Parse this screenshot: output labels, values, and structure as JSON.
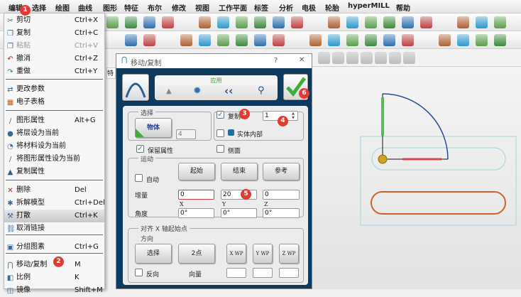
{
  "menubar": [
    "编辑",
    "选择",
    "绘图",
    "曲线",
    "图形",
    "特征",
    "布尔",
    "修改",
    "视图",
    "工作平面",
    "标签",
    "分析",
    "电极",
    "轮胎",
    "hyperMILL",
    "帮助"
  ],
  "edit_menu": [
    {
      "icon": "scissors-icon",
      "label": "剪切",
      "shortcut": "Ctrl+X"
    },
    {
      "icon": "copy-icon",
      "label": "复制",
      "shortcut": "Ctrl+C"
    },
    {
      "icon": "paste-icon",
      "label": "粘贴",
      "shortcut": "Ctrl+V",
      "disabled": true
    },
    {
      "icon": "undo-icon",
      "label": "撤消",
      "shortcut": "Ctrl+Z"
    },
    {
      "icon": "redo-icon",
      "label": "重做",
      "shortcut": "Ctrl+Y"
    },
    {
      "icon": "change-params-icon",
      "label": "更改参数",
      "shortcut": ""
    },
    {
      "icon": "spreadsheet-icon",
      "label": "电子表格",
      "shortcut": ""
    },
    {
      "icon": "pencil-icon",
      "label": "图形属性",
      "shortcut": "Alt+G"
    },
    {
      "icon": "layer-icon",
      "label": "将层设为当前",
      "shortcut": ""
    },
    {
      "icon": "material-icon",
      "label": "将材料设为当前",
      "shortcut": ""
    },
    {
      "icon": "attribute-icon",
      "label": "将图形属性设为当前",
      "shortcut": ""
    },
    {
      "icon": "brush-icon",
      "label": "复制属性",
      "shortcut": ""
    },
    {
      "icon": "delete-icon",
      "label": "删除",
      "shortcut": "Del"
    },
    {
      "icon": "explode-icon",
      "label": "拆解模型",
      "shortcut": "Ctrl+Del"
    },
    {
      "icon": "hammer-icon",
      "label": "打散",
      "shortcut": "Ctrl+K",
      "highlighted": true
    },
    {
      "icon": "unlink-icon",
      "label": "取消链接",
      "shortcut": ""
    },
    {
      "icon": "group-icon",
      "label": "分组图素",
      "shortcut": "Ctrl+G"
    },
    {
      "icon": "move-copy-icon",
      "label": "移动/复制",
      "shortcut": "M"
    },
    {
      "icon": "scale-icon",
      "label": "比例",
      "shortcut": "K"
    },
    {
      "icon": "mirror-icon",
      "label": "镜像",
      "shortcut": "Shift+M"
    }
  ],
  "badges": [
    "1",
    "2",
    "3",
    "4",
    "5",
    "6"
  ],
  "side_tab": "特",
  "dialog": {
    "title": "移动/复制",
    "help": "?",
    "close": "✕",
    "apply": "应用",
    "select_group": "选择",
    "object_btn": "物体",
    "object_count": "4",
    "copy_label": "复制",
    "copy_checked": true,
    "copy_count": "1",
    "solid_inside": "实体内部",
    "keep_attr": "保留属性",
    "keep_attr_checked": true,
    "side": "侧面",
    "motion_group": "运动",
    "auto": "自动",
    "start": "起始",
    "end": "结束",
    "reference": "参考",
    "increment": "增量",
    "inc_x": "0",
    "inc_y": "20",
    "inc_z": "0",
    "x": "X",
    "y": "Y",
    "z": "Z",
    "angle": "角度",
    "ang_x": "0°",
    "ang_y": "0°",
    "ang_z": "0°",
    "align_group": "对齐 X 轴起始点",
    "direction_group": "方向",
    "select_btn": "选择",
    "two_point": "2点",
    "xwp": "X WP",
    "ywp": "Y WP",
    "zwp": "Z WP",
    "reverse": "反向",
    "vector": "向量"
  },
  "colors": {
    "dialog_bg": "#0e3a5e",
    "badge": "#e23b32",
    "highlight_green": "#3cae3c"
  }
}
